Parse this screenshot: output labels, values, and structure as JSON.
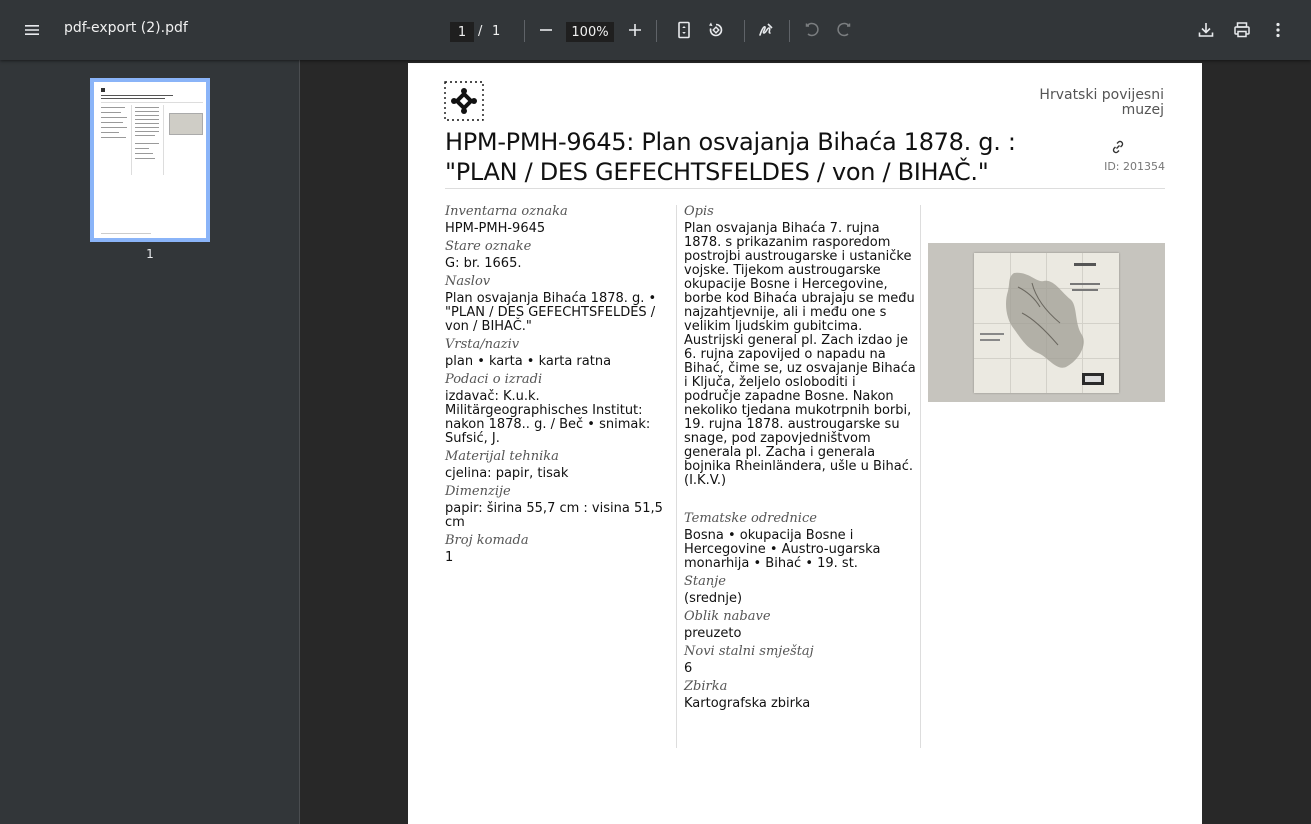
{
  "toolbar": {
    "file_name": "pdf-export (2).pdf",
    "page_current": "1",
    "page_separator": "/",
    "page_total": "1",
    "zoom": "100%"
  },
  "sidebar": {
    "thumbnail_page_number": "1"
  },
  "document": {
    "museum_name": "Hrvatski povijesni muzej",
    "title": "HPM-PMH-9645: Plan osvajanja Bihaća 1878. g. : \"PLAN / DES GEFECHTSFELDES / von / BIHAČ.\"",
    "id_label": "ID: 201354",
    "left_fields": [
      {
        "label": "Inventarna oznaka",
        "value": "HPM-PMH-9645"
      },
      {
        "label": "Stare oznake",
        "value": "G: br. 1665."
      },
      {
        "label": "Naslov",
        "value": "Plan osvajanja Bihaća 1878. g. • \"PLAN / DES GEFECHTSFELDES / von / BIHAČ.\""
      },
      {
        "label": "Vrsta/naziv",
        "value": "plan • karta • karta ratna"
      },
      {
        "label": "Podaci o izradi",
        "value": "izdavač: K.u.k. Militärgeographisches Institut: nakon 1878.. g. / Beč • snimak: Sufsić, J."
      },
      {
        "label": "Materijal tehnika",
        "value": "cjelina: papir, tisak"
      },
      {
        "label": "Dimenzije",
        "value": "papir: širina 55,7 cm : visina 51,5 cm"
      },
      {
        "label": "Broj komada",
        "value": "1"
      }
    ],
    "description_label": "Opis",
    "description": "Plan osvajanja Bihaća 7. rujna 1878. s prikazanim rasporedom postrojbi austrougarske i ustaničke vojske. Tijekom austrougarske okupacije Bosne i Hercegovine, borbe kod Bihaća ubrajaju se među najzahtjevnije, ali i među one s velikim ljudskim gubitcima. Austrijski general pl. Zach izdao je 6. rujna zapovijed o napadu na Bihać, čime se, uz osvajanje Bihaća i Ključa, željelo osloboditi i područje zapadne Bosne. Nakon nekoliko tjedana mukotrpnih borbi, 19. rujna 1878. austrougarske su snage, pod zapovjedništvom generala pl. Zacha i generala bojnika Rheinländera, ušle u Bihać. (I.K.V.)",
    "right_fields": [
      {
        "label": "Tematske odrednice",
        "value": "Bosna • okupacija Bosne i Hercegovine • Austro-ugarska monarhija • Bihać • 19. st."
      },
      {
        "label": "Stanje",
        "value": "(srednje)"
      },
      {
        "label": "Oblik nabave",
        "value": "preuzeto"
      },
      {
        "label": "Novi stalni smještaj",
        "value": "6"
      },
      {
        "label": "Zbirka",
        "value": "Kartografska zbirka"
      }
    ]
  },
  "colors": {
    "toolbar_bg": "#323639",
    "viewer_bg": "#282828",
    "thumb_border": "#8ab4f8"
  }
}
